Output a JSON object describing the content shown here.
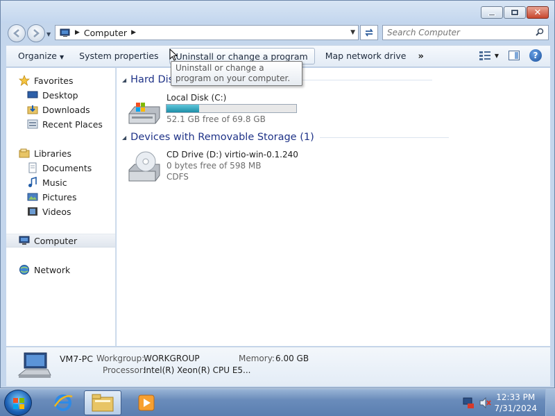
{
  "address_bar": {
    "crumb": "Computer",
    "search_placeholder": "Search Computer"
  },
  "toolbar": {
    "organize": "Organize",
    "system_properties": "System properties",
    "uninstall": "Uninstall or change a program",
    "map_drive": "Map network drive",
    "more": "»"
  },
  "tooltip": "Uninstall or change a program on your computer.",
  "nav": {
    "favorites": "Favorites",
    "desktop": "Desktop",
    "downloads": "Downloads",
    "recent_places": "Recent Places",
    "libraries": "Libraries",
    "documents": "Documents",
    "music": "Music",
    "pictures": "Pictures",
    "videos": "Videos",
    "computer": "Computer",
    "network": "Network"
  },
  "groups": {
    "hard_disks": "Hard Disk Drives (1)",
    "removable": "Devices with Removable Storage (1)"
  },
  "drives": {
    "local": {
      "name": "Local Disk (C:)",
      "free": "52.1 GB free of 69.8 GB",
      "used_fraction": 0.254
    },
    "cd": {
      "name": "CD Drive (D:) virtio-win-0.1.240",
      "free": "0 bytes free of 598 MB",
      "fs": "CDFS"
    }
  },
  "details": {
    "pc_name": "VM7-PC",
    "workgroup_label": "Workgroup:",
    "workgroup": "WORKGROUP",
    "memory_label": "Memory:",
    "memory": "6.00 GB",
    "processor_label": "Processor:",
    "processor": "Intel(R) Xeon(R) CPU E5..."
  },
  "taskbar": {
    "time": "12:33 PM",
    "date": "7/31/2024"
  },
  "colors": {
    "group_header": "#1e3287",
    "usage_fill": "#1d8ea7",
    "taskbar": "#6a8cbb"
  }
}
